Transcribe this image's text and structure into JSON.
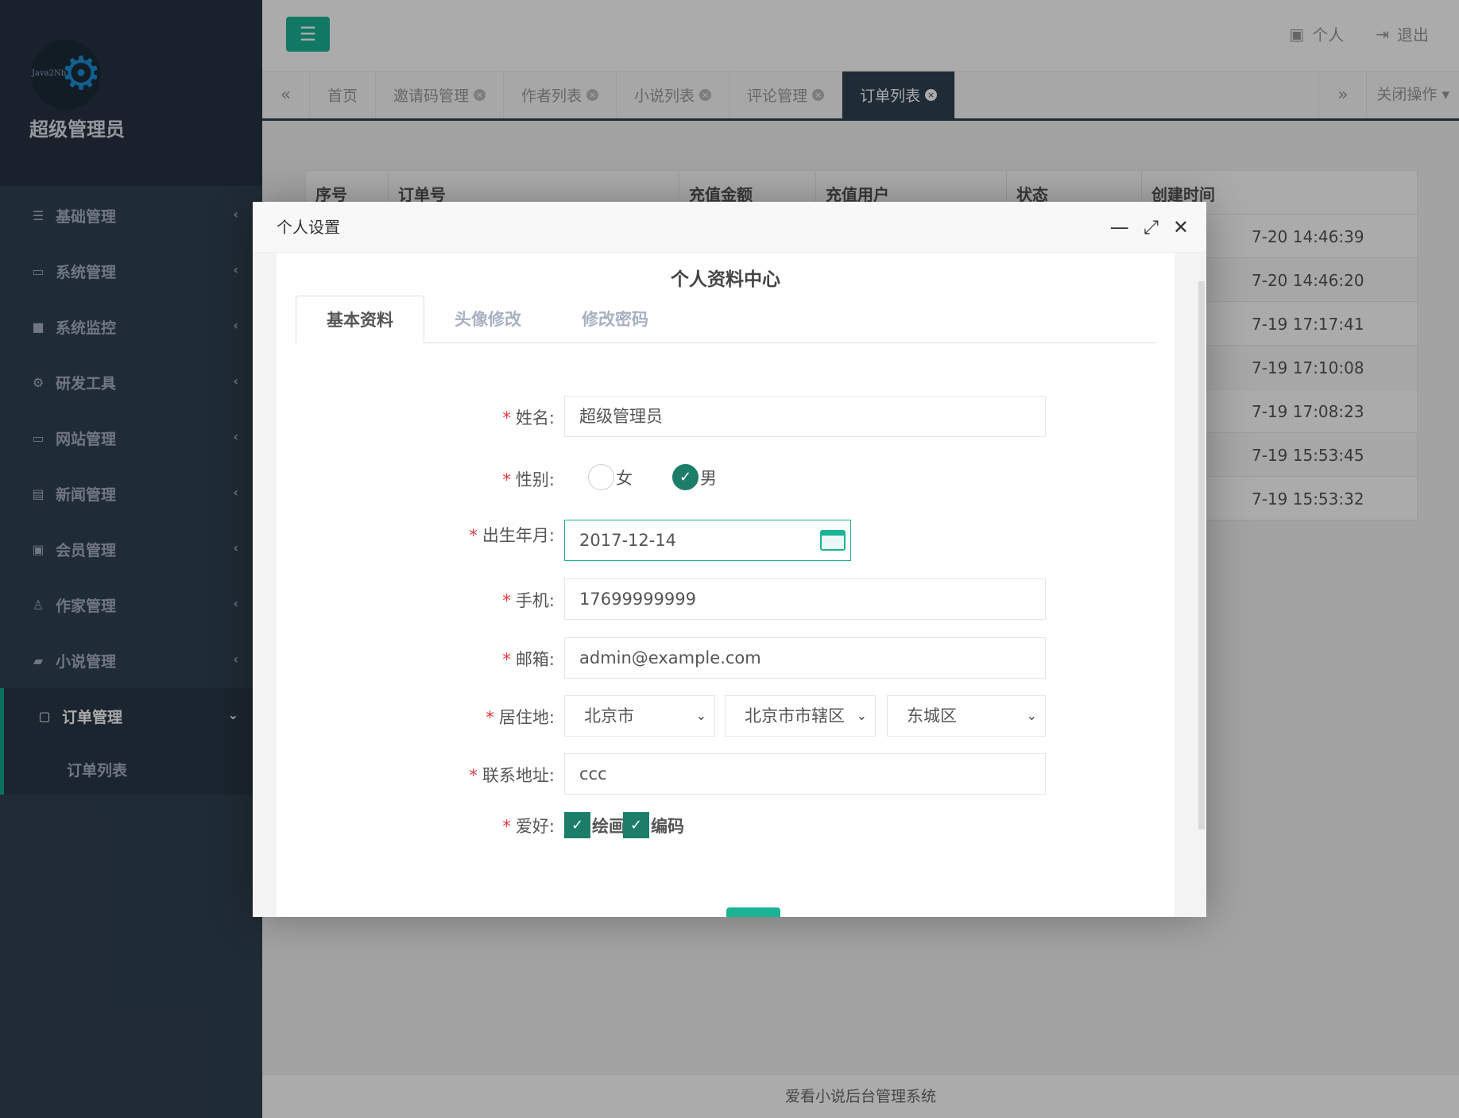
{
  "sidebar": {
    "logo_text": "Java2Nb",
    "admin_name": "超级管理员",
    "items": [
      {
        "label": "基础管理",
        "icon": "list-icon"
      },
      {
        "label": "系统管理",
        "icon": "desktop-icon"
      },
      {
        "label": "系统监控",
        "icon": "video-icon"
      },
      {
        "label": "研发工具",
        "icon": "gear-icon"
      },
      {
        "label": "网站管理",
        "icon": "desktop-icon"
      },
      {
        "label": "新闻管理",
        "icon": "newspaper-icon"
      },
      {
        "label": "会员管理",
        "icon": "id-card-icon"
      },
      {
        "label": "作家管理",
        "icon": "user-icon"
      },
      {
        "label": "小说管理",
        "icon": "book-icon"
      },
      {
        "label": "订单管理",
        "icon": "money-icon"
      }
    ],
    "subitem": "订单列表"
  },
  "header": {
    "personal": "个人",
    "logout": "退出"
  },
  "tabs": {
    "items": [
      "首页",
      "邀请码管理",
      "作者列表",
      "小说列表",
      "评论管理",
      "订单列表"
    ],
    "close_ops": "关闭操作"
  },
  "table": {
    "headers": [
      "序号",
      "订单号",
      "充值金额",
      "充值用户",
      "状态",
      "创建时间"
    ],
    "rows": [
      "7-20 14:46:39",
      "7-20 14:46:20",
      "7-19 17:17:41",
      "7-19 17:10:08",
      "7-19 17:08:23",
      "7-19 15:53:45",
      "7-19 15:53:32"
    ]
  },
  "footer": "爱看小说后台管理系统",
  "modal": {
    "title": "个人设置",
    "center_title": "个人资料中心",
    "subtabs": [
      "基本资料",
      "头像修改",
      "修改密码"
    ],
    "labels": {
      "name": "姓名:",
      "gender": "性别:",
      "birth": "出生年月:",
      "phone": "手机:",
      "email": "邮箱:",
      "residence": "居住地:",
      "address": "联系地址:",
      "hobby": "爱好:"
    },
    "values": {
      "name": "超级管理员",
      "gender_female": "女",
      "gender_male": "男",
      "birth": "2017-12-14",
      "phone": "17699999999",
      "email": "admin@example.com",
      "province": "北京市",
      "city": "北京市市辖区",
      "district": "东城区",
      "address": "ccc",
      "hobby1": "绘画",
      "hobby2": "编码"
    },
    "required_mark": "*"
  },
  "colors": {
    "sidebar_bg": "#2f4050",
    "accent": "#1ab394",
    "checked": "#1c7e68"
  }
}
